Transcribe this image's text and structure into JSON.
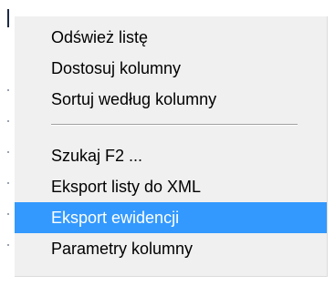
{
  "context_menu": {
    "group1": [
      {
        "label": "Odśwież listę"
      },
      {
        "label": "Dostosuj kolumny"
      },
      {
        "label": "Sortuj według kolumny"
      }
    ],
    "group2": [
      {
        "label": "Szukaj F2 ..."
      },
      {
        "label": "Eksport listy do XML"
      },
      {
        "label": "Eksport ewidencji",
        "highlighted": true
      },
      {
        "label": "Parametry kolumny"
      }
    ]
  },
  "colors": {
    "menu_background": "#f0f0f0",
    "highlight": "#3399ff",
    "highlight_text": "#ffffff",
    "separator": "#a0a0a0"
  }
}
